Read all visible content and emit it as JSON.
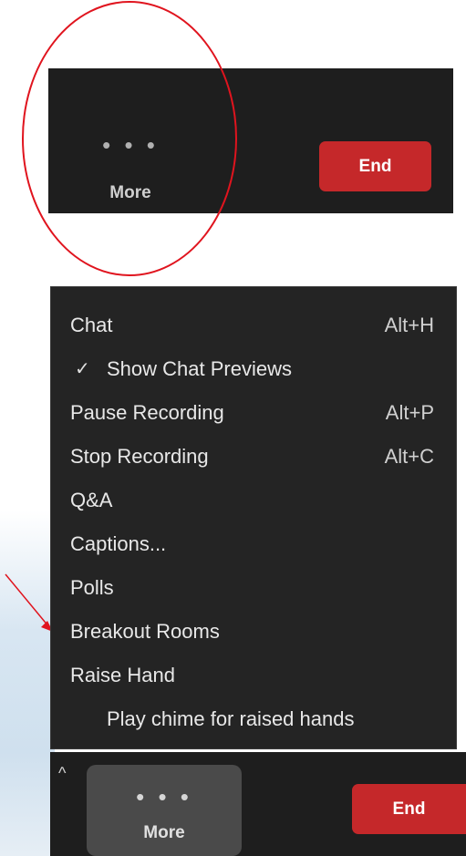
{
  "top_toolbar": {
    "more_dots": "• • •",
    "more_label": "More",
    "end_label": "End"
  },
  "menu": {
    "items": [
      {
        "label": "Chat",
        "shortcut": "Alt+H",
        "checked": false
      },
      {
        "label": "Show Chat Previews",
        "shortcut": "",
        "checked": true,
        "check_glyph": "✓"
      },
      {
        "label": "Pause Recording",
        "shortcut": "Alt+P",
        "checked": false
      },
      {
        "label": "Stop Recording",
        "shortcut": "Alt+C",
        "checked": false
      },
      {
        "label": "Q&A",
        "shortcut": "",
        "checked": false
      },
      {
        "label": "Captions...",
        "shortcut": "",
        "checked": false
      },
      {
        "label": "Polls",
        "shortcut": "",
        "checked": false
      },
      {
        "label": "Breakout Rooms",
        "shortcut": "",
        "checked": false
      },
      {
        "label": "Raise Hand",
        "shortcut": "",
        "checked": false
      },
      {
        "label": "Play chime for raised hands",
        "shortcut": "",
        "checked": false
      }
    ]
  },
  "bottom_toolbar": {
    "caret": "^",
    "more_dots": "• • •",
    "more_label": "More",
    "end_label": "End"
  },
  "colors": {
    "toolbar_bg": "#1e1e1e",
    "menu_bg": "#242424",
    "end_red": "#c5282a",
    "annotation_red": "#e0141e"
  }
}
